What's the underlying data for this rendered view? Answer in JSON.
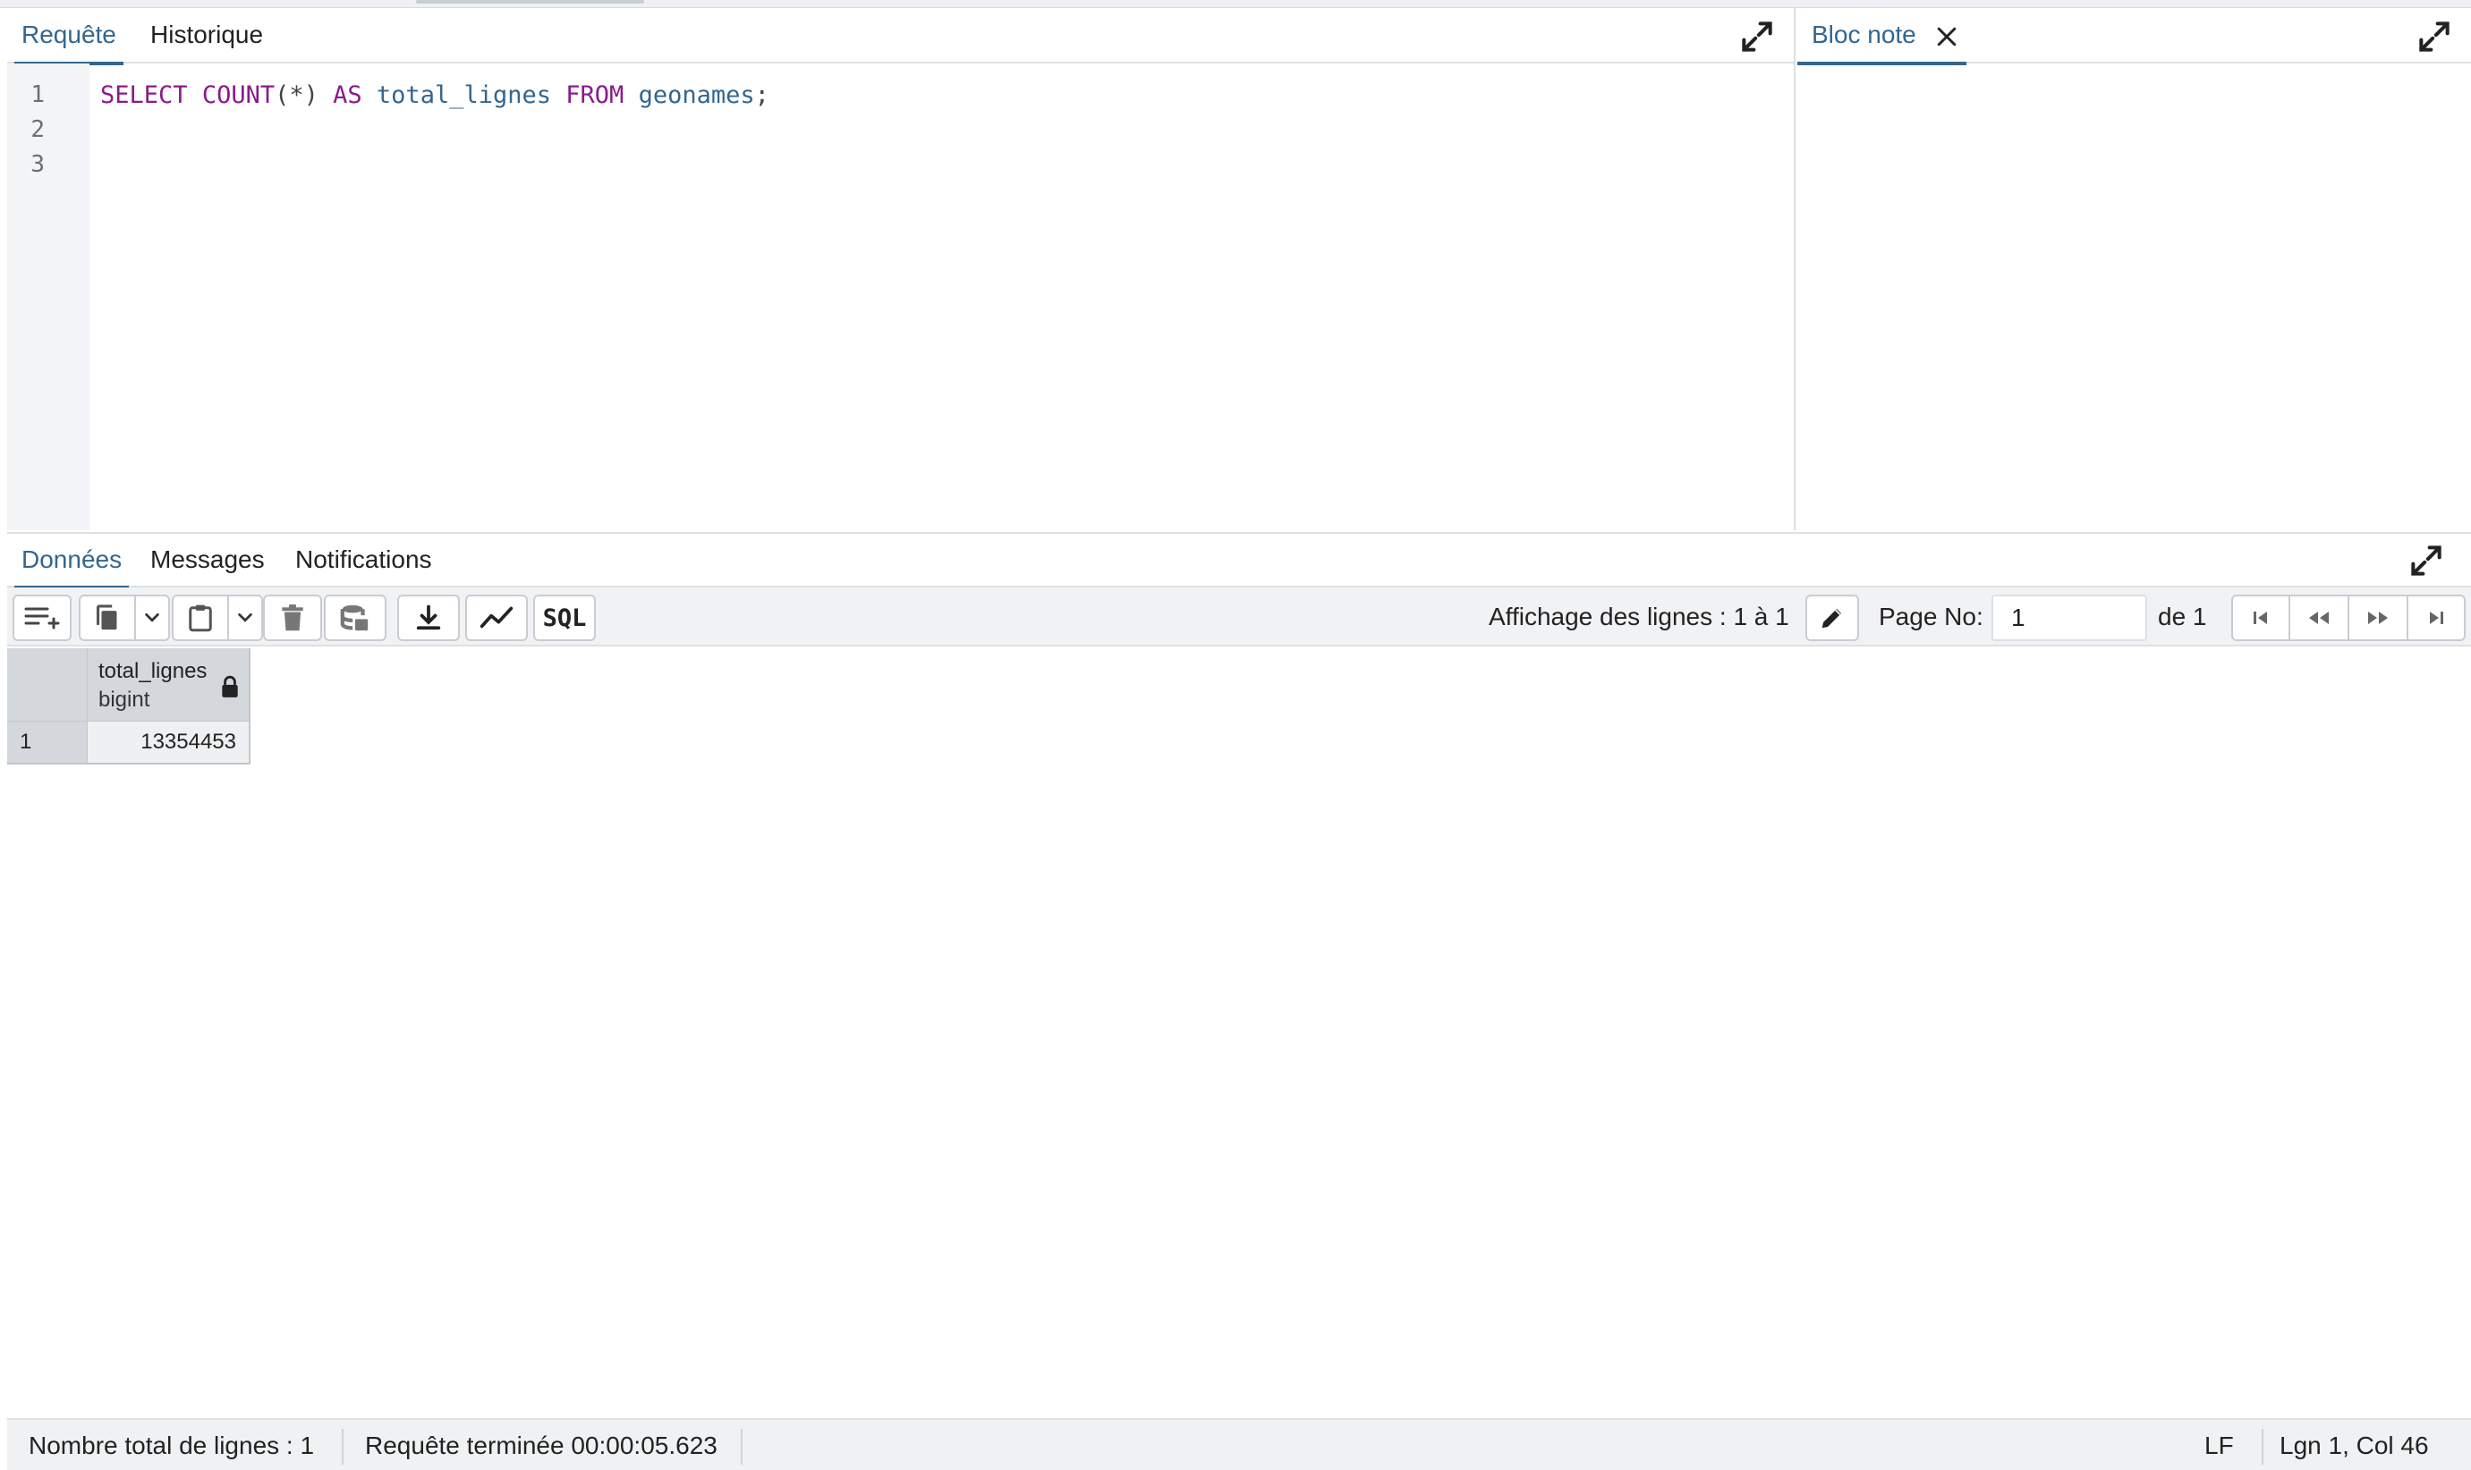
{
  "query_tabs": [
    {
      "label": "Requête",
      "active": true
    },
    {
      "label": "Historique",
      "active": false
    }
  ],
  "notepad": {
    "tab_label": "Bloc note"
  },
  "editor": {
    "line_numbers": [
      "1",
      "2",
      "3"
    ],
    "sql": {
      "kw_select": "SELECT",
      "fn_count": "COUNT",
      "args": "(*)",
      "kw_as": "AS",
      "alias": "total_lignes",
      "kw_from": "FROM",
      "table": "geonames",
      "terminator": ";"
    }
  },
  "result_tabs": [
    {
      "label": "Données",
      "active": true
    },
    {
      "label": "Messages",
      "active": false
    },
    {
      "label": "Notifications",
      "active": false
    }
  ],
  "toolbar": {
    "sql_label": "SQL",
    "rows_display": "Affichage des lignes : 1 à 1",
    "page_label": "Page No:",
    "page_value": "1",
    "page_total": "de 1"
  },
  "grid": {
    "columns": [
      {
        "name": "total_lignes",
        "type": "bigint"
      }
    ],
    "rows": [
      {
        "num": "1",
        "values": [
          "13354453"
        ]
      }
    ]
  },
  "status": {
    "total_rows": "Nombre total de lignes : 1",
    "query_done": "Requête terminée 00:00:05.623",
    "line_ending": "LF",
    "cursor": "Lgn 1, Col 46"
  },
  "colors": {
    "accent": "#326690",
    "keyword": "#8b1a8b"
  }
}
